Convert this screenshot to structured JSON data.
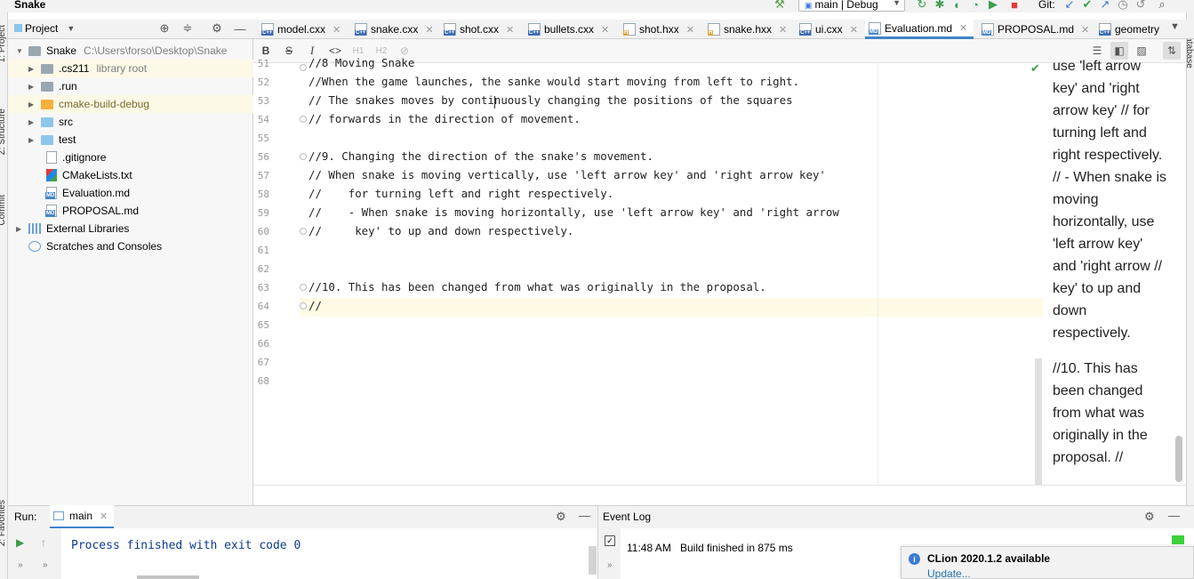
{
  "window": {
    "title": "Snake"
  },
  "toolbar": {
    "run_config": "main | Debug",
    "git_label": "Git:"
  },
  "left_stripe": {
    "project": "1: Project",
    "structure": "Z: Structure",
    "commit": "Commit",
    "favorites": "2: Favorites"
  },
  "right_stripe": {
    "database": "Database"
  },
  "project_panel": {
    "title": "Project",
    "tree": [
      {
        "name": "Snake",
        "hint": "C:\\Users\\forso\\Desktop\\Snake",
        "icon": "folder-icon"
      },
      {
        "name": ".cs211",
        "hint": "library root",
        "icon": "folder-icon"
      },
      {
        "name": ".run",
        "hint": "",
        "icon": "folder-icon"
      },
      {
        "name": "cmake-build-debug",
        "hint": "",
        "icon": "folder-icon"
      },
      {
        "name": "src",
        "hint": "",
        "icon": "folder-icon"
      },
      {
        "name": "test",
        "hint": "",
        "icon": "folder-icon"
      },
      {
        "name": ".gitignore",
        "hint": "",
        "icon": "file-icon"
      },
      {
        "name": "CMakeLists.txt",
        "hint": "",
        "icon": "cmake-icon"
      },
      {
        "name": "Evaluation.md",
        "hint": "",
        "icon": "markdown-icon"
      },
      {
        "name": "PROPOSAL.md",
        "hint": "",
        "icon": "markdown-icon"
      },
      {
        "name": "External Libraries",
        "hint": "",
        "icon": "library-icon"
      },
      {
        "name": "Scratches and Consoles",
        "hint": "",
        "icon": "scratches-icon"
      }
    ]
  },
  "tabs": [
    {
      "label": "model.cxx",
      "kind": "C++"
    },
    {
      "label": "snake.cxx",
      "kind": "C++"
    },
    {
      "label": "shot.cxx",
      "kind": "C++"
    },
    {
      "label": "bullets.cxx",
      "kind": "C++"
    },
    {
      "label": "shot.hxx",
      "kind": "H"
    },
    {
      "label": "snake.hxx",
      "kind": "H"
    },
    {
      "label": "ui.cxx",
      "kind": "C++"
    },
    {
      "label": "Evaluation.md",
      "kind": "MD"
    },
    {
      "label": "PROPOSAL.md",
      "kind": "MD"
    },
    {
      "label": "geometry",
      "kind": "C++"
    }
  ],
  "md_toolbar": {
    "bold": "B",
    "strike": "S",
    "italic": "I",
    "code": "<>",
    "h1": "H1",
    "h2": "H2",
    "link": "link-icon"
  },
  "editor": {
    "lines": [
      {
        "num": "51",
        "text": "//8 Moving Snake"
      },
      {
        "num": "52",
        "text": "//When the game launches, the sanke would start moving from left to right."
      },
      {
        "num": "53",
        "text": "// The snakes moves by continuously changing the positions of the squares"
      },
      {
        "num": "54",
        "text": "// forwards in the direction of movement."
      },
      {
        "num": "55",
        "text": ""
      },
      {
        "num": "56",
        "text": "//9. Changing the direction of the snake's movement."
      },
      {
        "num": "57",
        "text": "// When snake is moving vertically, use 'left arrow key' and 'right arrow key'"
      },
      {
        "num": "58",
        "text": "//    for turning left and right respectively."
      },
      {
        "num": "59",
        "text": "//    - When snake is moving horizontally, use 'left arrow key' and 'right arrow"
      },
      {
        "num": "60",
        "text": "//     key' to up and down respectively."
      },
      {
        "num": "61",
        "text": ""
      },
      {
        "num": "62",
        "text": ""
      },
      {
        "num": "63",
        "text": "//10. This has been changed from what was originally in the proposal."
      },
      {
        "num": "64",
        "text": "//"
      },
      {
        "num": "65",
        "text": ""
      },
      {
        "num": "66",
        "text": ""
      },
      {
        "num": "67",
        "text": ""
      },
      {
        "num": "68",
        "text": ""
      }
    ]
  },
  "preview": {
    "para1": [
      "use 'left arrow",
      "key' and 'right",
      "arrow key' // for",
      "turning left and",
      "right respectively.",
      "// - When snake is",
      "moving",
      "horizontally, use",
      "'left arrow key'",
      "and 'right arrow //",
      "key' to up and",
      "down",
      "respectively."
    ],
    "para2": [
      "//10. This has",
      "been changed",
      "from what was",
      "originally in the",
      "proposal. //"
    ]
  },
  "run_panel": {
    "label": "Run:",
    "tab": "main",
    "output": "Process finished with exit code 0"
  },
  "event_log": {
    "title": "Event Log",
    "entries": [
      {
        "time": "11:48 AM",
        "message": "Build finished in 875 ms"
      }
    ]
  },
  "notification": {
    "title": "CLion 2020.1.2 available",
    "link": "Update..."
  },
  "colors": {
    "accent": "#4083c9",
    "caret_line": "#fffae3",
    "success": "#3bd13b"
  }
}
